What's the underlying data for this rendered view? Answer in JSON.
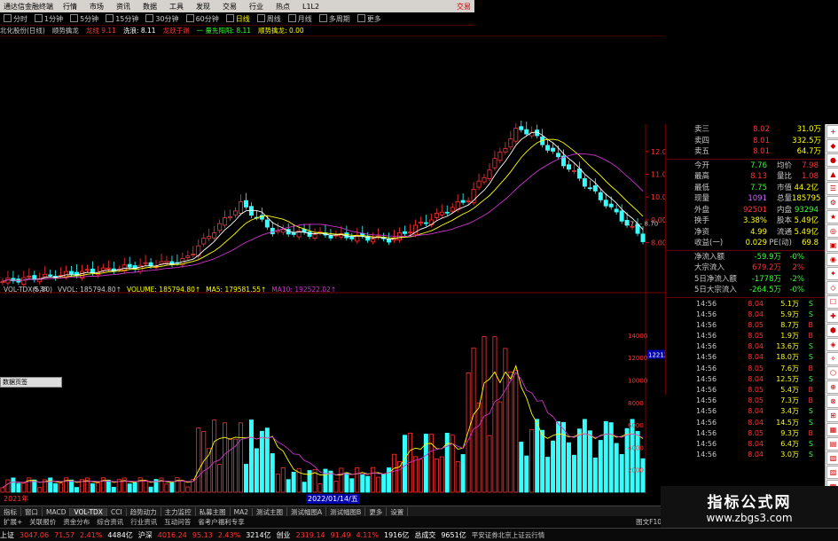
{
  "app": {
    "title": "通达信金融终端"
  },
  "menu": [
    "行情",
    "市场",
    "资讯",
    "数据",
    "工具",
    "发现",
    "交易",
    "行业",
    "热点",
    "L1L2"
  ],
  "menu_right": "交易",
  "periods": [
    {
      "label": "分时",
      "sel": false
    },
    {
      "label": "1分钟",
      "sel": false
    },
    {
      "label": "5分钟",
      "sel": false
    },
    {
      "label": "15分钟",
      "sel": false
    },
    {
      "label": "30分钟",
      "sel": false
    },
    {
      "label": "60分钟",
      "sel": false
    },
    {
      "label": "日线",
      "sel": true
    },
    {
      "label": "周线",
      "sel": false
    },
    {
      "label": "月线",
      "sel": false
    },
    {
      "label": "多周期",
      "sel": false
    },
    {
      "label": "更多",
      "sel": false
    }
  ],
  "info": {
    "stock": "北化股份(日线)",
    "indicator": "顺势擒龙",
    "a1": "龙线 9.11",
    "a2": "洗浪: 8.11",
    "a3": "龙跃于渊",
    "a4": "一 量先阳阳: 8.11",
    "a5": "顺势擒龙: 0.00"
  },
  "price_axis": [
    "12.00",
    "11.00",
    "10.00",
    "9.00",
    "8.00"
  ],
  "price_marks": {
    "low": "6.38",
    "right": "8.71 - 8.70"
  },
  "vol_info": {
    "t1": "VOL-TDX(5,10)",
    "t2": "VVOL: 185794.80↑",
    "t3": "VOLUME: 185794.80↑",
    "t4": "MA5: 179581.55↑",
    "t5": "MA10: 192522.02↑"
  },
  "vol_axis": [
    "14000",
    "12000",
    "10000",
    "8000",
    "6000",
    "4000",
    "2000"
  ],
  "vol_mark": "12213",
  "panel_button": "数据页签",
  "quotes": [
    {
      "l": "卖三",
      "v1": "8.02",
      "v2": "31.0万",
      "c1": "#ff3333",
      "c2": "#ffff00"
    },
    {
      "l": "卖四",
      "v1": "8.01",
      "v2": "332.5万",
      "c1": "#ff3333",
      "c2": "#ffff00"
    },
    {
      "l": "卖五",
      "v1": "8.01",
      "v2": "64.7万",
      "c1": "#ff3333",
      "c2": "#ffff00"
    }
  ],
  "stats": [
    {
      "l": "今开",
      "v1": "7.76",
      "l2": "均价",
      "v2": "7.98",
      "c1": "#33ff33",
      "c2": "#ff3333"
    },
    {
      "l": "最高",
      "v1": "8.13",
      "l2": "量比",
      "v2": "1.08",
      "c1": "#ff3333",
      "c2": "#ff3333"
    },
    {
      "l": "最低",
      "v1": "7.75",
      "l2": "市值",
      "v2": "44.2亿",
      "c1": "#33ff33",
      "c2": "#ffff00"
    },
    {
      "l": "现量",
      "v1": "1091",
      "l2": "总量",
      "v2": "185795",
      "c1": "#cc66ff",
      "c2": "#ffff00"
    },
    {
      "l": "外盘",
      "v1": "92501",
      "l2": "内盘",
      "v2": "93294",
      "c1": "#ff3333",
      "c2": "#33ff33"
    },
    {
      "l": "换手",
      "v1": "3.38%",
      "l2": "股本",
      "v2": "5.49亿",
      "c1": "#ffff00",
      "c2": "#ffff00"
    },
    {
      "l": "净资",
      "v1": "4.99",
      "l2": "流通",
      "v2": "5.49亿",
      "c1": "#ffff00",
      "c2": "#ffff00"
    },
    {
      "l": "收益(一)",
      "v1": "0.029",
      "l2": "PE(动)",
      "v2": "69.8",
      "c1": "#ffff00",
      "c2": "#ffff00"
    }
  ],
  "flows": [
    {
      "l": "净流入额",
      "v": "-59.9万",
      "p": "-0%",
      "c": "#33ff33"
    },
    {
      "l": "大宗流入",
      "v": "679.2万",
      "p": "2%",
      "c": "#ff3333"
    },
    {
      "l": "5日净流入额",
      "v": "-1778万",
      "p": "-2%",
      "c": "#33ff33"
    },
    {
      "l": "5日大宗流入",
      "v": "-264.5万",
      "p": "-0%",
      "c": "#33ff33"
    }
  ],
  "trades": [
    {
      "t": "14:56",
      "p": "8.04",
      "v": "5.1万",
      "d": "S"
    },
    {
      "t": "14:56",
      "p": "8.04",
      "v": "5.9万",
      "d": "S"
    },
    {
      "t": "14:56",
      "p": "8.05",
      "p_up": true,
      "v": "8.7万",
      "d": "B"
    },
    {
      "t": "14:56",
      "p": "8.05",
      "p_up": true,
      "v": "1.9万",
      "d": "B"
    },
    {
      "t": "14:56",
      "p": "8.04",
      "v": "13.6万",
      "d": "S"
    },
    {
      "t": "14:56",
      "p": "8.04",
      "v": "18.0万",
      "d": "S"
    },
    {
      "t": "14:56",
      "p": "8.05",
      "p_up": true,
      "v": "7.6万",
      "d": "B"
    },
    {
      "t": "14:56",
      "p": "8.04",
      "v": "12.5万",
      "d": "S"
    },
    {
      "t": "14:56",
      "p": "8.05",
      "p_up": true,
      "v": "5.4万",
      "d": "B"
    },
    {
      "t": "14:56",
      "p": "8.05",
      "p_up": true,
      "v": "7.3万",
      "d": "B"
    },
    {
      "t": "14:56",
      "p": "8.04",
      "v": "3.4万",
      "d": "S"
    },
    {
      "t": "14:56",
      "p": "8.04",
      "v": "14.5万",
      "d": "S"
    },
    {
      "t": "14:56",
      "p": "8.05",
      "p_up": true,
      "v": "9.3万",
      "d": "B"
    },
    {
      "t": "14:56",
      "p": "8.04",
      "v": "6.4万",
      "d": "S"
    },
    {
      "t": "14:56",
      "p": "8.04",
      "v": "3.0万",
      "d": "S"
    }
  ],
  "bottom_tabs": [
    "指标",
    "窗口",
    "MACD",
    "VOL-TDX",
    "CCI",
    "趋势动力",
    "主力监控",
    "私募主图",
    "MA2",
    "测试主图",
    "测试幅图A",
    "测试幅图B",
    "更多",
    "设置"
  ],
  "bottom_tab_sel": 3,
  "year_labels": {
    "y2021": "2021年",
    "date": "2022/01/14/五"
  },
  "strip_items": [
    "扩展+",
    "关联报价",
    "资金分布",
    "综合资讯",
    "行业资讯",
    "互动问答",
    "省考户福利专享"
  ],
  "strip_right": "图文F10",
  "status": {
    "sh_label": "上证",
    "sh_val": "3047.06",
    "sh_chg": "71.57",
    "sh_pct": "2.41%",
    "sh_amt": "4484亿",
    "hs_label": "沪深",
    "hs_val": "4016.24",
    "hs_chg": "95.13",
    "hs_pct": "2.43%",
    "hs_amt": "3214亿",
    "cy_label": "创业",
    "cy_val": "2319.14",
    "cy_chg": "91.49",
    "cy_pct": "4.11%",
    "cy_amt": "1916亿",
    "tot_label": "总成交",
    "tot_val": "9651亿",
    "broker": "平安证券北京上证云行情"
  },
  "watermark": {
    "l1": "指标公式网",
    "l2": "www.zbgs3.com"
  },
  "colors": {
    "up": "#ff3333",
    "down": "#33ffff",
    "ma5": "#ffffff",
    "ma10": "#ffff00",
    "ma20": "#cc33cc",
    "grid": "#800000"
  }
}
